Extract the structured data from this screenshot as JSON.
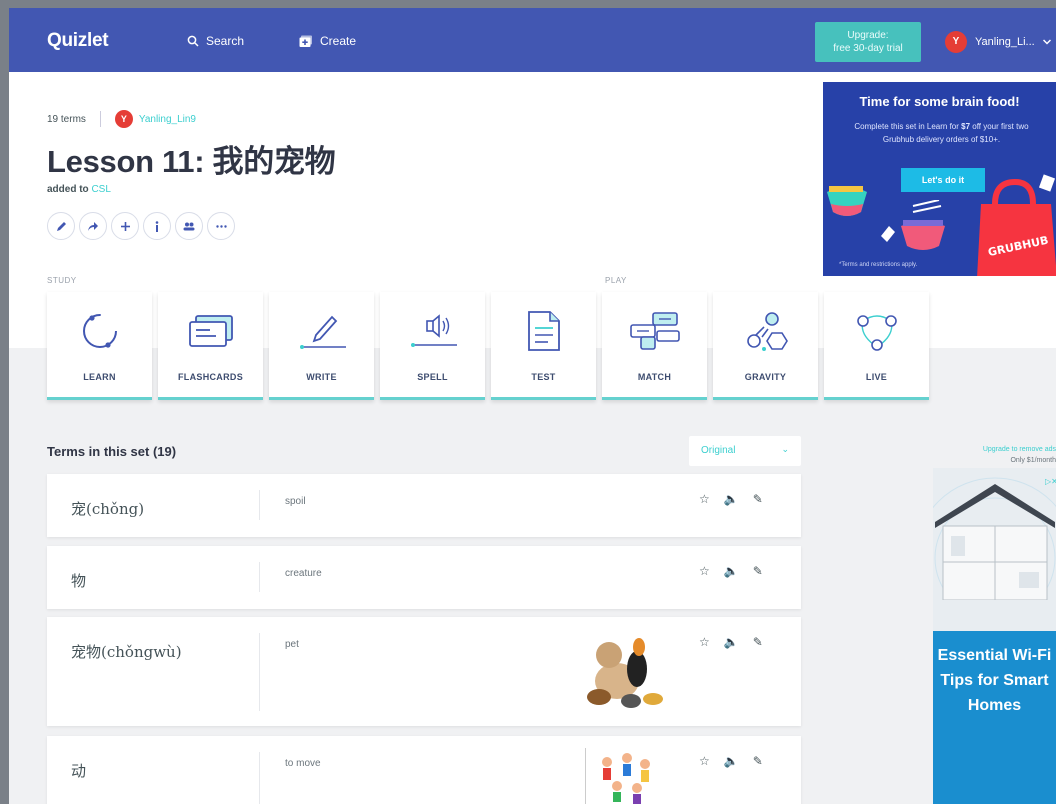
{
  "nav": {
    "logo": "Quizlet",
    "search": "Search",
    "create": "Create",
    "upgrade_line1": "Upgrade:",
    "upgrade_line2": "free 30-day trial",
    "user_initial": "Y",
    "user_name": "Yanling_Li..."
  },
  "set": {
    "term_count": "19 terms",
    "author_initial": "Y",
    "author": "Yanling_Lin9",
    "title": "Lesson 11: 我的宠物",
    "added_prefix": "added to ",
    "added_folder": "CSL"
  },
  "sections": {
    "study": "STUDY",
    "play": "PLAY"
  },
  "modes": [
    {
      "label": "LEARN"
    },
    {
      "label": "FLASHCARDS"
    },
    {
      "label": "WRITE"
    },
    {
      "label": "SPELL"
    },
    {
      "label": "TEST"
    },
    {
      "label": "MATCH"
    },
    {
      "label": "GRAVITY"
    },
    {
      "label": "LIVE"
    }
  ],
  "terms_header": "Terms in this set (19)",
  "sort": {
    "selected": "Original"
  },
  "terms": [
    {
      "term": "宠(chǒng)",
      "definition": "spoil"
    },
    {
      "term": "物",
      "definition": "creature"
    },
    {
      "term": "宠物(chǒngwù)",
      "definition": "pet"
    },
    {
      "term": "动",
      "definition": "to move"
    }
  ],
  "ad_top": {
    "headline": "Time for some brain food!",
    "body_1": "Complete this set in Learn for ",
    "body_amount": "$7",
    "body_2": " off your first two Grubhub delivery orders of $10+.",
    "cta": "Let's do it",
    "brand": "GRUBHUB",
    "fine": "*Terms and restrictions apply."
  },
  "ad_side": {
    "upgrade": "Upgrade to remove ads",
    "price": "Only $1/month",
    "headline": "Essential Wi-Fi Tips for Smart Homes"
  },
  "colors": {
    "brand": "#4257b2",
    "accent": "#3ccfcf",
    "upgrade": "#47c1bd"
  }
}
